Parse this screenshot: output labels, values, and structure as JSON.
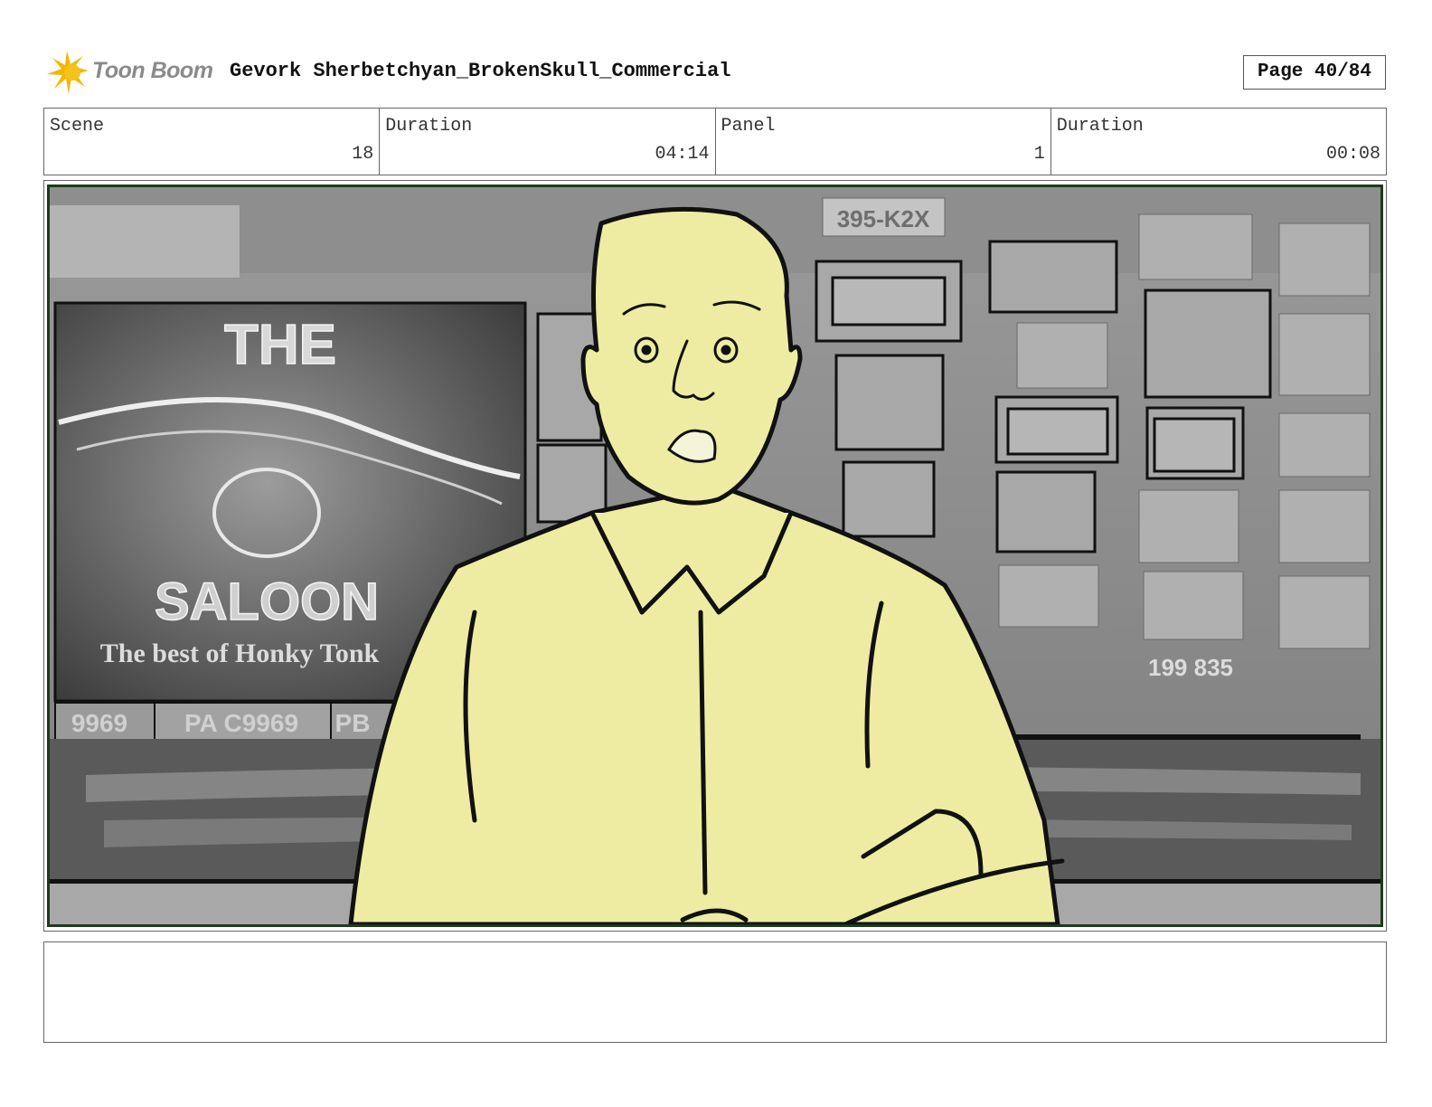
{
  "header": {
    "brand": "Toon Boom",
    "project_title": "Gevork Sherbetchyan_BrokenSkull_Commercial",
    "page_label": "Page 40/84"
  },
  "info": [
    {
      "label": "Scene",
      "value": "18"
    },
    {
      "label": "Duration",
      "value": "04:14"
    },
    {
      "label": "Panel",
      "value": "1"
    },
    {
      "label": "Duration",
      "value": "00:08"
    }
  ],
  "panel": {
    "sign_top": "THE",
    "sign_bottom": "SALOON",
    "sign_tagline": "The best of Honky Tonk",
    "plate_top": "395-K2X",
    "plate_a": "9969",
    "plate_b": "PA C9969",
    "plate_c": "PB",
    "plate_right": "199 835",
    "colors": {
      "figure_fill": "#eeeca2",
      "ink": "#111111",
      "frame": "#1e3a1e"
    }
  },
  "notes": {
    "text": ""
  }
}
